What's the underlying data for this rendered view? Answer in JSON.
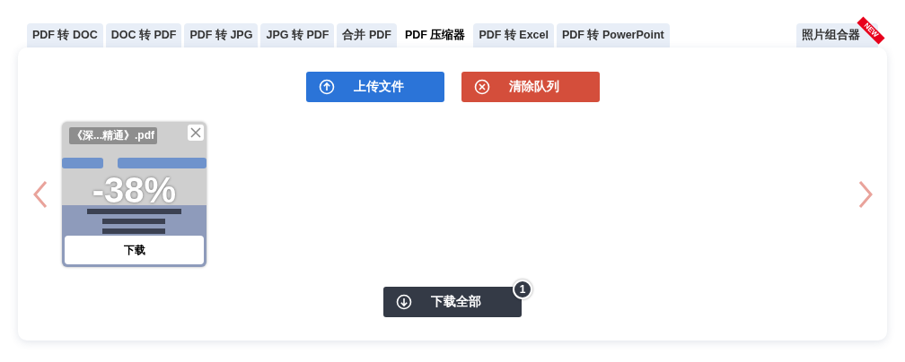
{
  "tabs": [
    {
      "label": "PDF 转 DOC",
      "selected": false
    },
    {
      "label": "DOC 转 PDF",
      "selected": false
    },
    {
      "label": "PDF 转 JPG",
      "selected": false
    },
    {
      "label": "JPG 转 PDF",
      "selected": false
    },
    {
      "label": "合并 PDF",
      "selected": false
    },
    {
      "label": "PDF 压缩器",
      "selected": true
    },
    {
      "label": "PDF 转 Excel",
      "selected": false
    },
    {
      "label": "PDF 转 PowerPoint",
      "selected": false
    }
  ],
  "side_tab": {
    "label": "照片组合器",
    "ribbon": "NEW",
    "selected": false
  },
  "actions": [
    {
      "kind": "upload",
      "label": "上传文件"
    },
    {
      "kind": "clear",
      "label": "清除队列"
    }
  ],
  "files": [
    {
      "name": "《深...精通》.pdf",
      "reduction": "-38%",
      "download": "下载"
    }
  ],
  "download_all": {
    "label": "下载全部",
    "count": "1"
  }
}
